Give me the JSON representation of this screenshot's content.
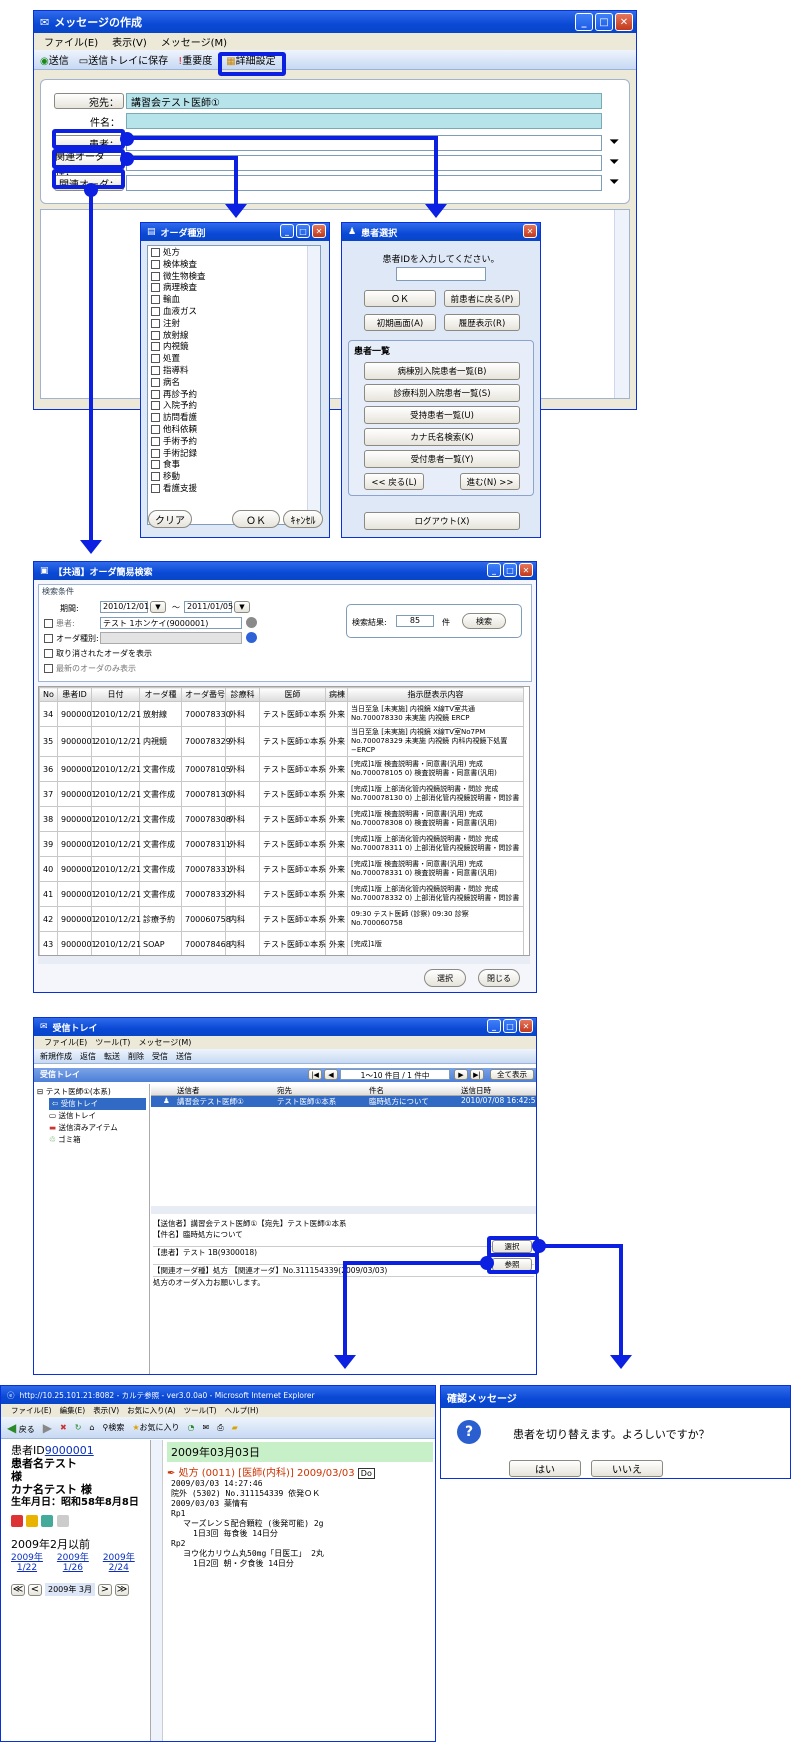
{
  "compose": {
    "title": "メッセージの作成",
    "menu": [
      "ファイル(E)",
      "表示(V)",
      "メッセージ(M)"
    ],
    "toolbar": {
      "send": "送信",
      "save": "送信トレイに保存",
      "priority": "重要度",
      "detail": "詳細設定"
    },
    "to_label": "宛先：",
    "to_value": "講習会テスト医師①",
    "subject_label": "件名：",
    "patient_label": "患者：",
    "order_type_label": "関連オーダ種：",
    "order_label": "関連オーダ："
  },
  "order_type": {
    "title": "オーダ種別",
    "items": [
      "処方",
      "検体検査",
      "微生物検査",
      "病理検査",
      "輸血",
      "血液ガス",
      "注射",
      "放射線",
      "内視鏡",
      "処置",
      "指導料",
      "病名",
      "再診予約",
      "入院予約",
      "訪問看護",
      "他科依頼",
      "手術予約",
      "手術記録",
      "食事",
      "移動",
      "看護支援"
    ],
    "clear": "クリア",
    "ok": "ＯＫ",
    "cancel": "ｷｬﾝｾﾙ"
  },
  "patient_select": {
    "title": "患者選択",
    "prompt": "患者IDを入力してください。",
    "ok": "ＯＫ",
    "prev": "前患者に戻る(P)",
    "initial": "初期画面(A)",
    "history": "履歴表示(R)",
    "list_title": "患者一覧",
    "lists": [
      "病棟別入院患者一覧(B)",
      "診療科別入院患者一覧(S)",
      "受持患者一覧(U)",
      "カナ氏名検索(K)",
      "受付患者一覧(Y)"
    ],
    "back": "<< 戻る(L)",
    "next": "進む(N) >>",
    "logout": "ログアウト(X)"
  },
  "order_search": {
    "title": "【共通】オーダ簡易検索",
    "cond_title": "検索条件",
    "period_label": "期間:",
    "from": "2010/12/01",
    "tilde": "～",
    "to": "2011/01/05",
    "patient_label": "患者:",
    "patient_value": "テスト 1ホンケイ(9000001)",
    "type_label": "オーダ種別:",
    "cancelled": "取り消されたオーダを表示",
    "latest": "最新のオーダのみ表示",
    "result_label": "検索結果:",
    "result_count": "85",
    "result_unit": "件",
    "search": "検索",
    "headers": [
      "No",
      "患者ID",
      "日付",
      "オーダ種",
      "オーダ番号",
      "診療科",
      "医師",
      "病棟",
      "指示歴表示内容"
    ],
    "rows": [
      [
        "34",
        "9000001",
        "2010/12/21",
        "放射線",
        "700078330",
        "外科",
        "テスト医師①本系",
        "外来",
        "当日至急 [未実施] 内視鏡 X線TV室共通 No.700078330 未実施 内視鏡 ERCP"
      ],
      [
        "35",
        "9000001",
        "2010/12/21",
        "内視鏡",
        "700078329",
        "外科",
        "テスト医師①本系",
        "外来",
        "当日至急 [未実施] 内視鏡 X線TV室No7PM No.700078329 未実施 内視鏡 内科内視鏡下処置−ERCP"
      ],
      [
        "36",
        "9000001",
        "2010/12/21",
        "文書作成",
        "700078105",
        "外科",
        "テスト医師①本系",
        "外来",
        "[完成]1版 検査説明書・同意書(汎用) 完成 No.700078105 0) 検査説明書・同意書(汎用)"
      ],
      [
        "37",
        "9000001",
        "2010/12/21",
        "文書作成",
        "700078130",
        "外科",
        "テスト医師①本系",
        "外来",
        "[完成]1版 上部消化管内視鏡説明書・問診 完成 No.700078130 0) 上部消化管内視鏡説明書・問診書"
      ],
      [
        "38",
        "9000001",
        "2010/12/21",
        "文書作成",
        "700078308",
        "外科",
        "テスト医師①本系",
        "外来",
        "[完成]1版 検査説明書・同意書(汎用) 完成 No.700078308 0) 検査説明書・同意書(汎用)"
      ],
      [
        "39",
        "9000001",
        "2010/12/21",
        "文書作成",
        "700078311",
        "外科",
        "テスト医師①本系",
        "外来",
        "[完成]1版 上部消化管内視鏡説明書・問診 完成 No.700078311 0) 上部消化管内視鏡説明書・問診書"
      ],
      [
        "40",
        "9000001",
        "2010/12/21",
        "文書作成",
        "700078331",
        "外科",
        "テスト医師①本系",
        "外来",
        "[完成]1版 検査説明書・同意書(汎用) 完成 No.700078331 0) 検査説明書・同意書(汎用)"
      ],
      [
        "41",
        "9000001",
        "2010/12/21",
        "文書作成",
        "700078332",
        "外科",
        "テスト医師①本系",
        "外来",
        "[完成]1版 上部消化管内視鏡説明書・問診 完成 No.700078332 0) 上部消化管内視鏡説明書・問診書"
      ],
      [
        "42",
        "9000001",
        "2010/12/21",
        "診療予約",
        "700060758",
        "内科",
        "テスト医師①本系",
        "外来",
        "09:30 テスト医師 (診察) 09:30 診察 No.700060758"
      ],
      [
        "43",
        "9000001",
        "2010/12/21",
        "SOAP",
        "700078468",
        "内科",
        "テスト医師①本系",
        "外来",
        "[完成]1版"
      ]
    ],
    "select": "選択",
    "close": "閉じる"
  },
  "inbox": {
    "title": "受信トレイ",
    "menu": [
      "ファイル(E)",
      "ツール(T)",
      "メッセージ(M)"
    ],
    "toolbar": [
      "新規作成",
      "返信",
      "転送",
      "削除",
      "受信",
      "送信"
    ],
    "pane_title": "受信トレイ",
    "pager": "1〜10 件目 / 1 件中",
    "show_all": "全て表示",
    "tree": [
      "テスト医師①(本系)",
      "受信トレイ",
      "送信トレイ",
      "送信済みアイテム",
      "ゴミ箱"
    ],
    "cols": [
      "送信者",
      "宛先",
      "件名",
      "送信日時"
    ],
    "row": [
      "講習会テスト医師①",
      "テスト医師①本系",
      "臨時処方について",
      "2010/07/08 16:42:5"
    ],
    "preview_header": "【送信者】講習会テスト医師①【宛先】テスト医師①本系",
    "preview_subject": "【件名】臨時処方について",
    "preview_patient": "【患者】テスト 1B(9300018)",
    "preview_order": "【関連オーダ種】処方 【関連オーダ】No.311154339(2009/03/03)",
    "preview_body": "処方のオーダ入力お願いします。",
    "select": "選択",
    "ref": "参照"
  },
  "ie": {
    "title": "http://10.25.101.21:8082 - カルテ参照 - ver3.0.0a0 - Microsoft Internet Explorer",
    "menu": [
      "ファイル(E)",
      "編集(E)",
      "表示(V)",
      "お気に入り(A)",
      "ツール(T)",
      "ヘルプ(H)"
    ],
    "back": "戻る",
    "search": "検索",
    "fav": "お気に入り",
    "patient_id_label": "患者ID",
    "patient_id": "9000001",
    "patient_name": "患者名テスト",
    "honorific": "様",
    "kana": "カナ名テスト 様",
    "birth": "生年月日：昭和58年8月8日",
    "before": "2009年2月以前",
    "links": [
      [
        "2009年",
        "1/22"
      ],
      [
        "2009年",
        "1/26"
      ],
      [
        "2009年",
        "2/24"
      ]
    ],
    "month_nav": "2009年 3月",
    "date": "2009年03月03日",
    "rx_title": "処方 (0011) [医師(内科)] 2009/03/03",
    "rx_badge": "Do",
    "lines": [
      "2009/03/03 14:27:46",
      "院外 (5302) No.311154339 依発ＯＫ",
      "2009/03/03 薬情有",
      "Rp1",
      "マーズレンＳ配合顆粒 (後発可能) 2g",
      "1日3回 毎食後 14日分",
      "Rp2",
      "ヨウ化カリウム丸50mg「日医工」 2丸",
      "1日2回 朝・夕食後 14日分"
    ]
  },
  "confirm": {
    "title": "確認メッセージ",
    "message": "患者を切り替えます。よろしいですか？",
    "yes": "はい",
    "no": "いいえ"
  }
}
